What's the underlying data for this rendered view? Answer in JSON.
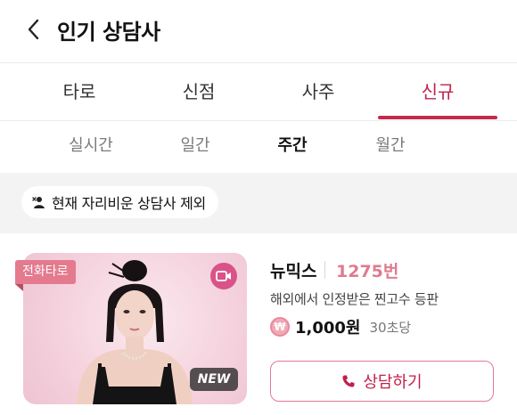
{
  "header": {
    "title": "인기 상담사"
  },
  "category_tabs": [
    {
      "label": "타로",
      "active": false
    },
    {
      "label": "신점",
      "active": false
    },
    {
      "label": "사주",
      "active": false
    },
    {
      "label": "신규",
      "active": true
    }
  ],
  "period_tabs": [
    {
      "label": "실시간",
      "active": false
    },
    {
      "label": "일간",
      "active": false
    },
    {
      "label": "주간",
      "active": true
    },
    {
      "label": "월간",
      "active": false
    }
  ],
  "filter": {
    "label": "현재 자리비운 상담사 제외",
    "icon": "person-away-icon"
  },
  "counselor": {
    "type_badge": "전화타로",
    "new_badge": "NEW",
    "video_icon": "video-camera-icon",
    "name": "뉴믹스",
    "number": "1275번",
    "description": "해외에서 인정받은 찐고수 등판",
    "coin_symbol": "₩",
    "price": "1,000원",
    "price_unit": "30초당",
    "consult_button": "상담하기",
    "consult_icon": "phone-icon"
  },
  "colors": {
    "accent": "#c2204a",
    "accent_light": "#e07b8f",
    "badge": "#e47a8e",
    "filter_bg": "#f3f3f3"
  }
}
